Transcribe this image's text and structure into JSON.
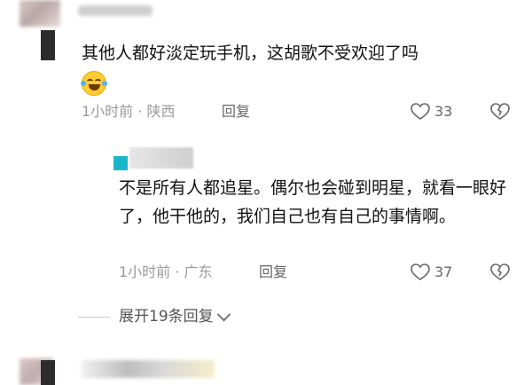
{
  "comment": {
    "text": "其他人都好淡定玩手机，这胡歌不受欢迎了吗",
    "meta": "1小时前 · 陕西",
    "reply_label": "回复",
    "like_count": "33"
  },
  "reply": {
    "text": "不是所有人都追星。偶尔也会碰到明星，就看一眼好了，他干他的，我们自己也有自己的事情啊。",
    "meta": "1小时前 · 广东",
    "reply_label": "回复",
    "like_count": "37"
  },
  "expand": {
    "label": "展开19条回复"
  }
}
